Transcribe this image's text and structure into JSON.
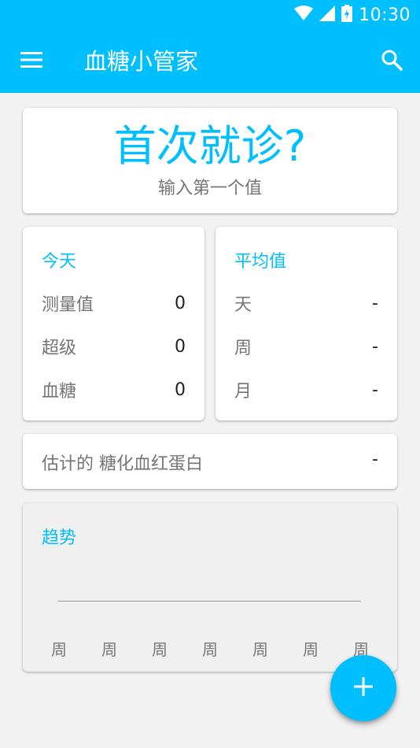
{
  "status_bar": {
    "time": "10:30",
    "icons": [
      "wifi-icon",
      "signal-icon",
      "battery-icon"
    ]
  },
  "app_bar": {
    "title": "血糖小管家",
    "menu_icon": "menu-icon",
    "search_icon": "search-icon"
  },
  "hero": {
    "title": "首次就诊?",
    "subtitle": "输入第一个值"
  },
  "today": {
    "header": "今天",
    "rows": [
      {
        "label": "测量值",
        "value": "0"
      },
      {
        "label": "超级",
        "value": "0"
      },
      {
        "label": "血糖",
        "value": "0"
      }
    ]
  },
  "average": {
    "header": "平均值",
    "rows": [
      {
        "label": "天",
        "value": "-"
      },
      {
        "label": "周",
        "value": "-"
      },
      {
        "label": "月",
        "value": "-"
      }
    ]
  },
  "hba1c": {
    "label": "估计的 糖化血红蛋白",
    "value": "-"
  },
  "trend": {
    "title": "趋势",
    "x_labels": [
      "周",
      "周",
      "周",
      "周",
      "周",
      "周",
      "周"
    ]
  },
  "fab": {
    "icon": "plus-icon"
  },
  "colors": {
    "accent": "#00bfff",
    "background": "#f2f2f2",
    "card": "#ffffff",
    "text_secondary": "#757575",
    "text_primary": "#222222"
  }
}
